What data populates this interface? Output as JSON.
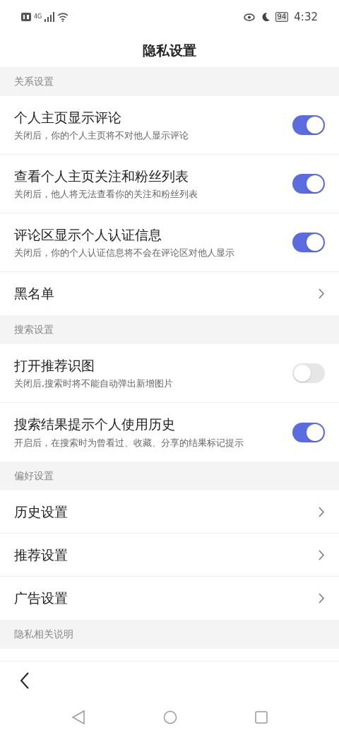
{
  "status_bar": {
    "battery": "94",
    "time": "4:32",
    "network": "4G"
  },
  "title": "隐私设置",
  "sections": [
    {
      "header": "关系设置",
      "items": [
        {
          "kind": "toggle",
          "title": "个人主页显示评论",
          "description": "关闭后，你的个人主页将不对他人显示评论",
          "on": true
        },
        {
          "kind": "toggle",
          "title": "查看个人主页关注和粉丝列表",
          "description": "关闭后，他人将无法查看你的关注和粉丝列表",
          "on": true
        },
        {
          "kind": "toggle",
          "title": "评论区显示个人认证信息",
          "description": "关闭后，你的个人认证信息将不会在评论区对他人显示",
          "on": true
        },
        {
          "kind": "link",
          "title": "黑名单"
        }
      ]
    },
    {
      "header": "搜索设置",
      "items": [
        {
          "kind": "toggle",
          "title": "打开推荐识图",
          "description": "关闭后,搜索时将不能自动弹出新增图片",
          "on": false
        },
        {
          "kind": "toggle",
          "title": "搜索结果提示个人使用历史",
          "description": "开启后，在搜索时为曾看过、收藏、分享的结果标记提示",
          "on": true
        }
      ]
    },
    {
      "header": "偏好设置",
      "items": [
        {
          "kind": "link",
          "title": "历史设置"
        },
        {
          "kind": "link",
          "title": "推荐设置"
        },
        {
          "kind": "link",
          "title": "广告设置"
        }
      ]
    },
    {
      "header": "隐私相关说明"
    }
  ]
}
